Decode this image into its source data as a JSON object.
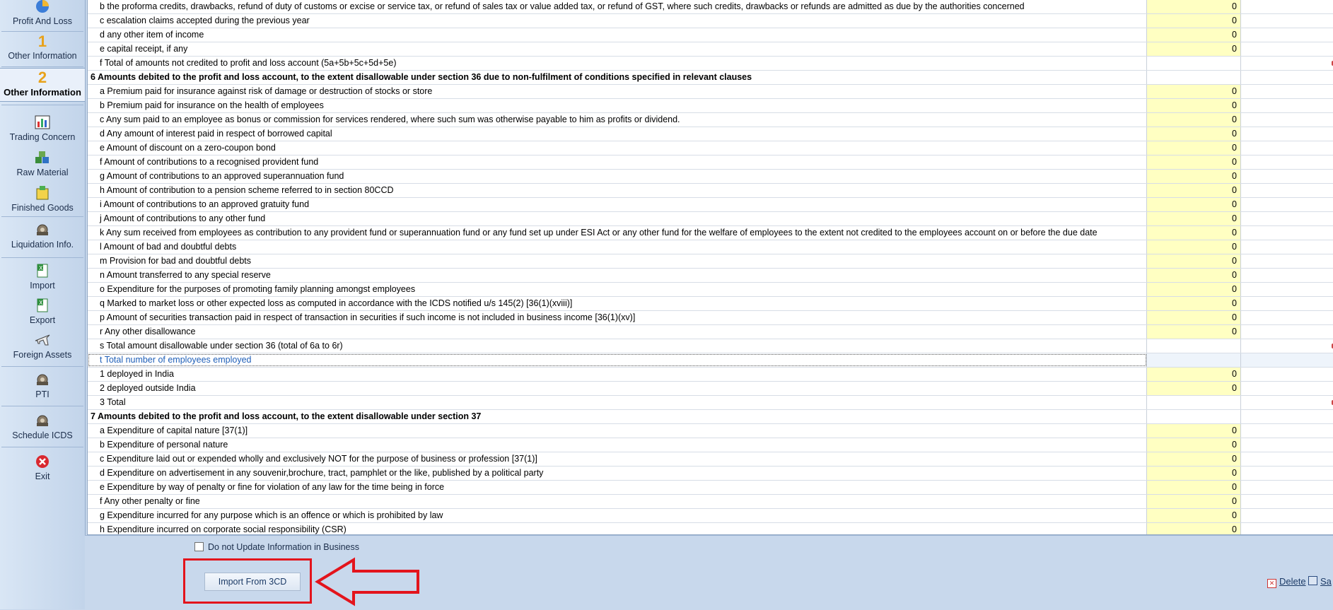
{
  "sidebar": {
    "items": [
      {
        "name": "profit-and-loss",
        "label": "Profit And Loss",
        "icon": "pie-chart-icon"
      },
      {
        "name": "other-information-1",
        "label": "Other Information",
        "number": "1"
      },
      {
        "name": "other-information-2",
        "label": "Other Information",
        "number": "2"
      },
      {
        "name": "trading-concern",
        "label": "Trading Concern",
        "icon": "chart-icon"
      },
      {
        "name": "raw-material",
        "label": "Raw Material",
        "icon": "cubes-icon"
      },
      {
        "name": "finished-goods",
        "label": "Finished Goods",
        "icon": "box-icon"
      },
      {
        "name": "liquidation-info",
        "label": "Liquidation Info.",
        "icon": "gear-icon"
      },
      {
        "name": "import",
        "label": "Import",
        "icon": "excel-icon"
      },
      {
        "name": "export",
        "label": "Export",
        "icon": "excel-icon"
      },
      {
        "name": "foreign-assets",
        "label": "Foreign Assets",
        "icon": "airplane-icon"
      },
      {
        "name": "pti",
        "label": "PTI",
        "icon": "gear-icon"
      },
      {
        "name": "schedule-icds",
        "label": "Schedule ICDS",
        "icon": "gear-icon"
      },
      {
        "name": "exit",
        "label": "Exit",
        "icon": "close-icon"
      }
    ]
  },
  "rows": [
    {
      "text": "b the proforma credits, drawbacks, refund of duty of customs or excise or service tax, or refund of sales tax or value added tax, or refund of GST, where such credits, drawbacks or refunds are admitted as due by the authorities concerned",
      "value": "0",
      "type": "input"
    },
    {
      "text": "c escalation claims accepted during the previous year",
      "value": "0",
      "type": "input"
    },
    {
      "text": "d any other item of income",
      "value": "0",
      "type": "input"
    },
    {
      "text": "e capital receipt, if any",
      "value": "0",
      "type": "input"
    },
    {
      "text": "f Total of amounts not credited to profit and loss account (5a+5b+5c+5d+5e)",
      "value": "",
      "type": "total"
    },
    {
      "text": "6 Amounts debited to the profit and loss account, to the extent disallowable under section 36 due to non-fulfilment of conditions specified in relevant clauses",
      "value": "",
      "type": "header"
    },
    {
      "text": "a Premium paid for insurance against risk of damage or destruction of stocks or store",
      "value": "0",
      "type": "input"
    },
    {
      "text": "b Premium paid for insurance on the health of employees",
      "value": "0",
      "type": "input"
    },
    {
      "text": "c Any sum paid to an employee as bonus or commission for services rendered, where such sum was otherwise payable to him as profits or dividend.",
      "value": "0",
      "type": "input"
    },
    {
      "text": "d Any amount of interest paid in respect of borrowed capital",
      "value": "0",
      "type": "input"
    },
    {
      "text": "e Amount of discount on a zero-coupon bond",
      "value": "0",
      "type": "input"
    },
    {
      "text": "f Amount of contributions to a recognised provident fund",
      "value": "0",
      "type": "input"
    },
    {
      "text": "g Amount of contributions to an approved superannuation fund",
      "value": "0",
      "type": "input"
    },
    {
      "text": "h Amount of contribution to a pension scheme referred to in section 80CCD",
      "value": "0",
      "type": "input"
    },
    {
      "text": "i Amount of contributions to an approved gratuity fund",
      "value": "0",
      "type": "input"
    },
    {
      "text": "j Amount of contributions to any other fund",
      "value": "0",
      "type": "input"
    },
    {
      "text": "k Any sum received from employees as contribution to any provident fund or superannuation fund or any fund set up under ESI Act or any other fund for the welfare of employees to the extent not credited to the employees account on or  before the due date",
      "value": "0",
      "type": "input"
    },
    {
      "text": "l Amount of bad and doubtful debts",
      "value": "0",
      "type": "input"
    },
    {
      "text": "m Provision for bad and doubtful debts",
      "value": "0",
      "type": "input"
    },
    {
      "text": "n Amount transferred to any special reserve",
      "value": "0",
      "type": "input"
    },
    {
      "text": "o Expenditure for the purposes of promoting family planning amongst employees",
      "value": "0",
      "type": "input"
    },
    {
      "text": "q Marked to market loss or other expected loss as computed in accordance with the ICDS notified u/s 145(2) [36(1)(xviii)]",
      "value": "0",
      "type": "input"
    },
    {
      "text": "p Amount of securities transaction paid in respect of transaction in securities if such income is not included in business income [36(1)(xv)]",
      "value": "0",
      "type": "input"
    },
    {
      "text": "r Any other disallowance",
      "value": "0",
      "type": "input"
    },
    {
      "text": "s Total amount disallowable under section 36 (total of 6a to 6r)",
      "value": "",
      "type": "total"
    },
    {
      "text": "t Total  number of employees employed",
      "value": "",
      "type": "selected"
    },
    {
      "text": "1 deployed in India",
      "value": "0",
      "type": "input"
    },
    {
      "text": "2 deployed outside India",
      "value": "0",
      "type": "input"
    },
    {
      "text": "3 Total",
      "value": "",
      "type": "total"
    },
    {
      "text": "7 Amounts debited to the profit and loss account, to the extent disallowable under section 37",
      "value": "",
      "type": "header"
    },
    {
      "text": "a Expenditure of capital nature [37(1)]",
      "value": "0",
      "type": "input"
    },
    {
      "text": "b Expenditure of personal nature",
      "value": "0",
      "type": "input"
    },
    {
      "text": "c Expenditure laid out or expended wholly and exclusively NOT for the purpose of business or profession [37(1)]",
      "value": "0",
      "type": "input"
    },
    {
      "text": "d Expenditure on advertisement in any souvenir,brochure, tract, pamphlet or the like, published by a political party",
      "value": "0",
      "type": "input"
    },
    {
      "text": "e Expenditure by way of penalty or fine for violation of any law for the time being in force",
      "value": "0",
      "type": "input"
    },
    {
      "text": "f Any other penalty or fine",
      "value": "0",
      "type": "input"
    },
    {
      "text": "g Expenditure incurred for any purpose which is an offence or which is prohibited by law",
      "value": "0",
      "type": "input"
    },
    {
      "text": "h Expenditure incurred on corporate social responsibility (CSR)",
      "value": "0",
      "type": "input"
    }
  ],
  "footer": {
    "no_update_label": "Do not Update Information in Business",
    "import_button": "Import From 3CD",
    "delete_label": "Delete",
    "save_label": "Sa"
  },
  "colors": {
    "input_cell": "#ffffc2",
    "highlight": "#e3141c",
    "selected_text": "#1f5fb8"
  }
}
